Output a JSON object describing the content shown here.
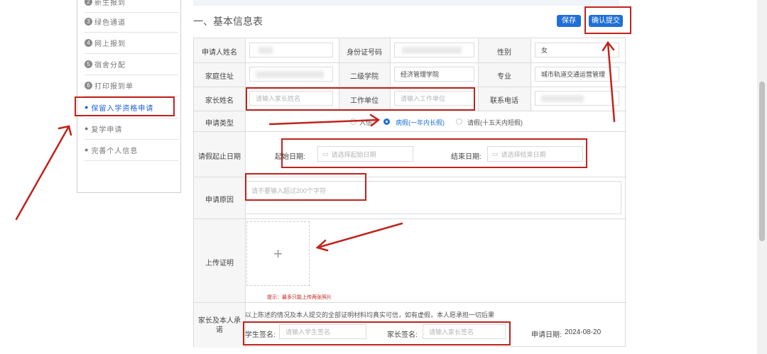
{
  "sidebar": {
    "items": [
      {
        "num": "2",
        "label": "新生报到"
      },
      {
        "num": "3",
        "label": "绿色通道"
      },
      {
        "num": "4",
        "label": "网上报到"
      },
      {
        "num": "5",
        "label": "宿舍分配"
      },
      {
        "num": "6",
        "label": "打印报到单"
      },
      {
        "num": "",
        "label": "保留入学资格申请",
        "active": true
      },
      {
        "num": "",
        "label": "复学申请"
      },
      {
        "num": "",
        "label": "完善个人信息"
      }
    ]
  },
  "page": {
    "section_title": "一、基本信息表",
    "save_label": "保存",
    "submit_label": "确认提交"
  },
  "form": {
    "applicant_name_label": "申请人姓名",
    "id_number_label": "身份证号码",
    "gender_label": "性别",
    "gender_value": "女",
    "address_label": "家庭住址",
    "college_label": "二级学院",
    "college_value": "经济管理学院",
    "major_label": "专业",
    "major_value": "城市轨道交通运营管理",
    "parent_name_label": "家长姓名",
    "parent_name_placeholder": "请输入家长姓名",
    "work_unit_label": "工作单位",
    "work_unit_placeholder": "请输入工作单位",
    "phone_label": "联系电话",
    "apply_type_label": "申请类型",
    "apply_type_options": [
      "入伍",
      "病假(一年内长假)",
      "请假(十五天内短假)"
    ],
    "apply_type_selected": "病假(一年内长假)",
    "leave_period_label": "请假起止日期",
    "start_date_label": "起始日期:",
    "start_date_placeholder": "请选择起始日期",
    "end_date_label": "结束日期:",
    "end_date_placeholder": "请选择结束日期",
    "reason_label": "申请原因",
    "reason_placeholder": "请不要输入超过200个字符",
    "upload_label": "上传证明",
    "upload_plus": "+",
    "upload_hint": "提示：最多只能上传两张照片",
    "promise_label_1": "家长及本人承",
    "promise_label_2": "诺",
    "promise_text": "以上陈述的情况及本人提交的全部证明材料均真实可信，如有虚假，本人愿承担一切后果",
    "student_sign_label": "学生签名:",
    "student_sign_placeholder": "请输入学生签名",
    "parent_sign_label": "家长签名:",
    "parent_sign_placeholder": "请输入家长签名",
    "apply_date_label": "申请日期:",
    "apply_date_value": "2024-08-20"
  },
  "colors": {
    "accent": "#1f6fd6",
    "annotation_red": "#c0231c"
  }
}
